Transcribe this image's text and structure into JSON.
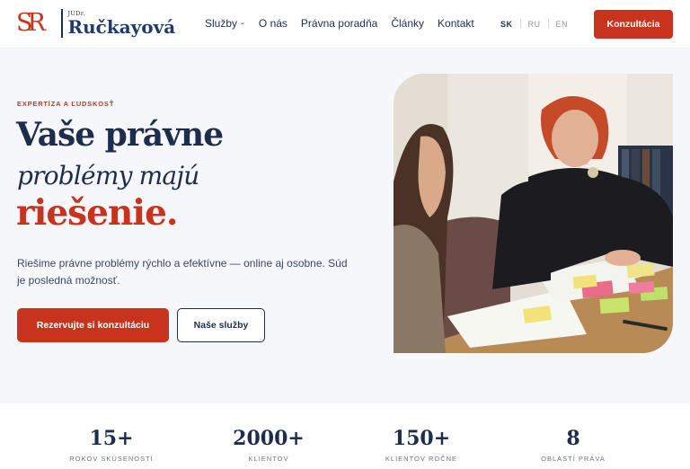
{
  "brand": {
    "monogram": "SR",
    "title_prefix": "JUDr.",
    "name": "Ručkayová"
  },
  "nav": [
    {
      "label": "Služby",
      "has_dropdown": true
    },
    {
      "label": "O nás"
    },
    {
      "label": "Právna poradňa"
    },
    {
      "label": "Články"
    },
    {
      "label": "Kontakt"
    }
  ],
  "languages": [
    {
      "code": "SK",
      "active": true
    },
    {
      "code": "RU",
      "active": false
    },
    {
      "code": "EN",
      "active": false
    }
  ],
  "header_cta": "Konzultácia",
  "hero": {
    "eyebrow": "EXPERTÍZA A ĽUDSKOSŤ",
    "headline_line1": "Vaše právne",
    "headline_line2": "problémy majú",
    "headline_line3": "riešenie.",
    "lead": "Riešime právne problémy rýchlo a efektívne — online aj osobne. Súd je posledná možnosť.",
    "primary_button": "Rezervujte si konzultáciu",
    "secondary_button": "Naše služby"
  },
  "stats": [
    {
      "value": "15+",
      "label": "ROKOV SKÚSENOSTÍ"
    },
    {
      "value": "2000+",
      "label": "KLIENTOV"
    },
    {
      "value": "150+",
      "label": "KLIENTOV ROČNE"
    },
    {
      "value": "8",
      "label": "OBLASTÍ PRÁVA"
    }
  ],
  "colors": {
    "accent": "#c8331e",
    "navy": "#1f2d4d",
    "background": "#f6f7fa"
  }
}
